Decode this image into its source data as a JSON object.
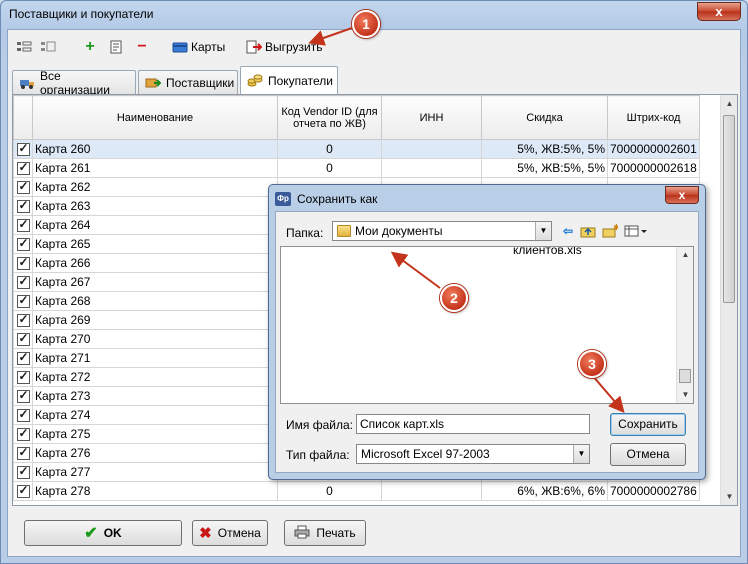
{
  "window": {
    "title": "Поставщики и покупатели",
    "close_glyph": "x"
  },
  "toolbar": {
    "cards_label": "Карты",
    "export_label": "Выгрузить",
    "add_glyph": "+",
    "remove_glyph": "−"
  },
  "tabs": [
    {
      "label": "Все организации"
    },
    {
      "label": "Поставщики"
    },
    {
      "label": "Покупатели"
    }
  ],
  "grid": {
    "columns": [
      "Наименование",
      "Код Vendor ID (для отчета по ЖВ)",
      "ИНН",
      "Скидка",
      "Штрих-код"
    ],
    "rows": [
      {
        "name": "Карта 260",
        "vendor": "0",
        "inn": "",
        "discount": "5%, ЖВ:5%, 5%",
        "barcode": "7000000002601"
      },
      {
        "name": "Карта 261",
        "vendor": "0",
        "inn": "",
        "discount": "5%, ЖВ:5%, 5%",
        "barcode": "7000000002618"
      },
      {
        "name": "Карта 262",
        "vendor": "",
        "inn": "",
        "discount": "",
        "barcode": ""
      },
      {
        "name": "Карта 263",
        "vendor": "",
        "inn": "",
        "discount": "",
        "barcode": ""
      },
      {
        "name": "Карта 264",
        "vendor": "",
        "inn": "",
        "discount": "",
        "barcode": ""
      },
      {
        "name": "Карта 265",
        "vendor": "",
        "inn": "",
        "discount": "",
        "barcode": ""
      },
      {
        "name": "Карта 266",
        "vendor": "",
        "inn": "",
        "discount": "",
        "barcode": ""
      },
      {
        "name": "Карта 267",
        "vendor": "",
        "inn": "",
        "discount": "",
        "barcode": ""
      },
      {
        "name": "Карта 268",
        "vendor": "",
        "inn": "",
        "discount": "",
        "barcode": ""
      },
      {
        "name": "Карта 269",
        "vendor": "",
        "inn": "",
        "discount": "",
        "barcode": ""
      },
      {
        "name": "Карта 270",
        "vendor": "",
        "inn": "",
        "discount": "",
        "barcode": ""
      },
      {
        "name": "Карта 271",
        "vendor": "",
        "inn": "",
        "discount": "",
        "barcode": ""
      },
      {
        "name": "Карта 272",
        "vendor": "",
        "inn": "",
        "discount": "",
        "barcode": ""
      },
      {
        "name": "Карта 273",
        "vendor": "",
        "inn": "",
        "discount": "",
        "barcode": ""
      },
      {
        "name": "Карта 274",
        "vendor": "",
        "inn": "",
        "discount": "",
        "barcode": ""
      },
      {
        "name": "Карта 275",
        "vendor": "",
        "inn": "",
        "discount": "",
        "barcode": ""
      },
      {
        "name": "Карта 276",
        "vendor": "",
        "inn": "",
        "discount": "",
        "barcode": ""
      },
      {
        "name": "Карта 277",
        "vendor": "",
        "inn": "",
        "discount": "",
        "barcode": ""
      },
      {
        "name": "Карта 278",
        "vendor": "0",
        "inn": "",
        "discount": "6%, ЖВ:6%, 6%",
        "barcode": "7000000002786"
      }
    ]
  },
  "buttons": {
    "ok": "OK",
    "cancel": "Отмена",
    "print": "Печать"
  },
  "dialog": {
    "title": "Сохранить как",
    "icon_text": "Фр",
    "folder_label": "Папка:",
    "folder_value": "Мои документы",
    "file_list_item": "клиентов.xls",
    "filename_label": "Имя файла:",
    "filename_value": "Список карт.xls",
    "filetype_label": "Тип файла:",
    "filetype_value": "Microsoft Excel 97-2003",
    "save_label": "Сохранить",
    "cancel_label": "Отмена"
  },
  "annotations": [
    "1",
    "2",
    "3"
  ],
  "colors": {
    "accent_red": "#c4341c",
    "selection": "#dde9f7",
    "title_bar": "#b9cde6"
  }
}
